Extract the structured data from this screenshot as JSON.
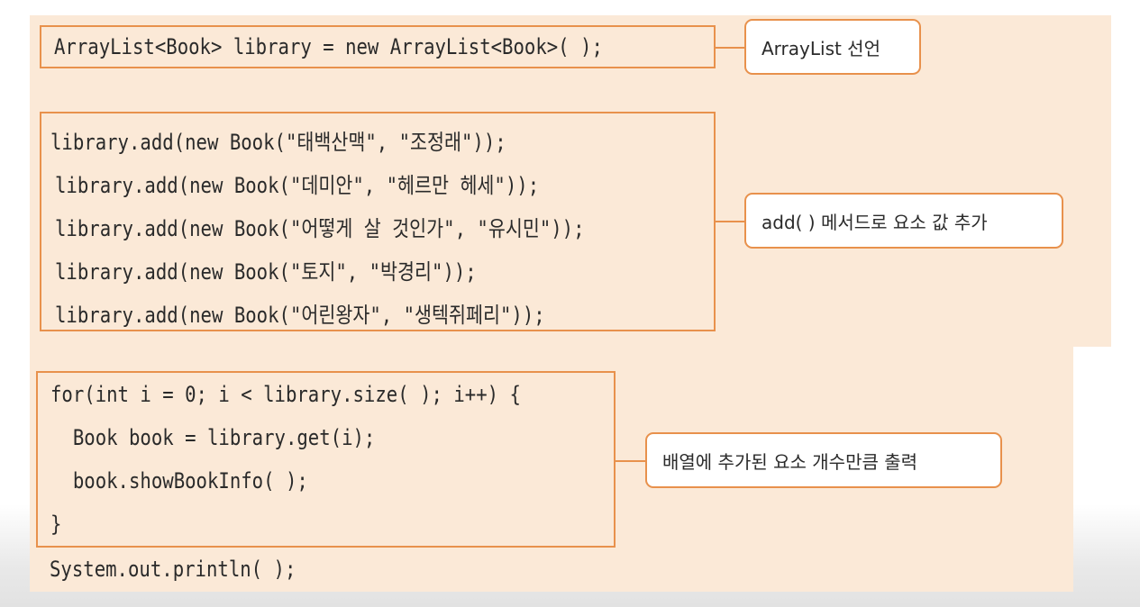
{
  "colors": {
    "panel_background": "#fbe9d7",
    "box_border": "#e8914c",
    "text": "#2a2a2a"
  },
  "declaration": {
    "code": "ArrayList<Book> library = new ArrayList<Book>( );",
    "note": "ArrayList 선언"
  },
  "add_block": {
    "lines": [
      "library.add(new Book(\"태백산맥\", \"조정래\"));",
      "library.add(new Book(\"데미안\", \"헤르만 헤세\"));",
      "library.add(new Book(\"어떻게 살 것인가\", \"유시민\"));",
      "library.add(new Book(\"토지\", \"박경리\"));",
      "library.add(new Book(\"어린왕자\", \"생텍쥐페리\"));"
    ],
    "note": "add( ) 메서드로 요소 값 추가"
  },
  "loop_block": {
    "lines": [
      "for(int i = 0; i < library.size( ); i++) {",
      "  Book book = library.get(i);",
      "  book.showBookInfo( );",
      "}"
    ],
    "note": "배열에 추가된 요소 개수만큼 출력"
  },
  "trailing_line": "System.out.println( );"
}
